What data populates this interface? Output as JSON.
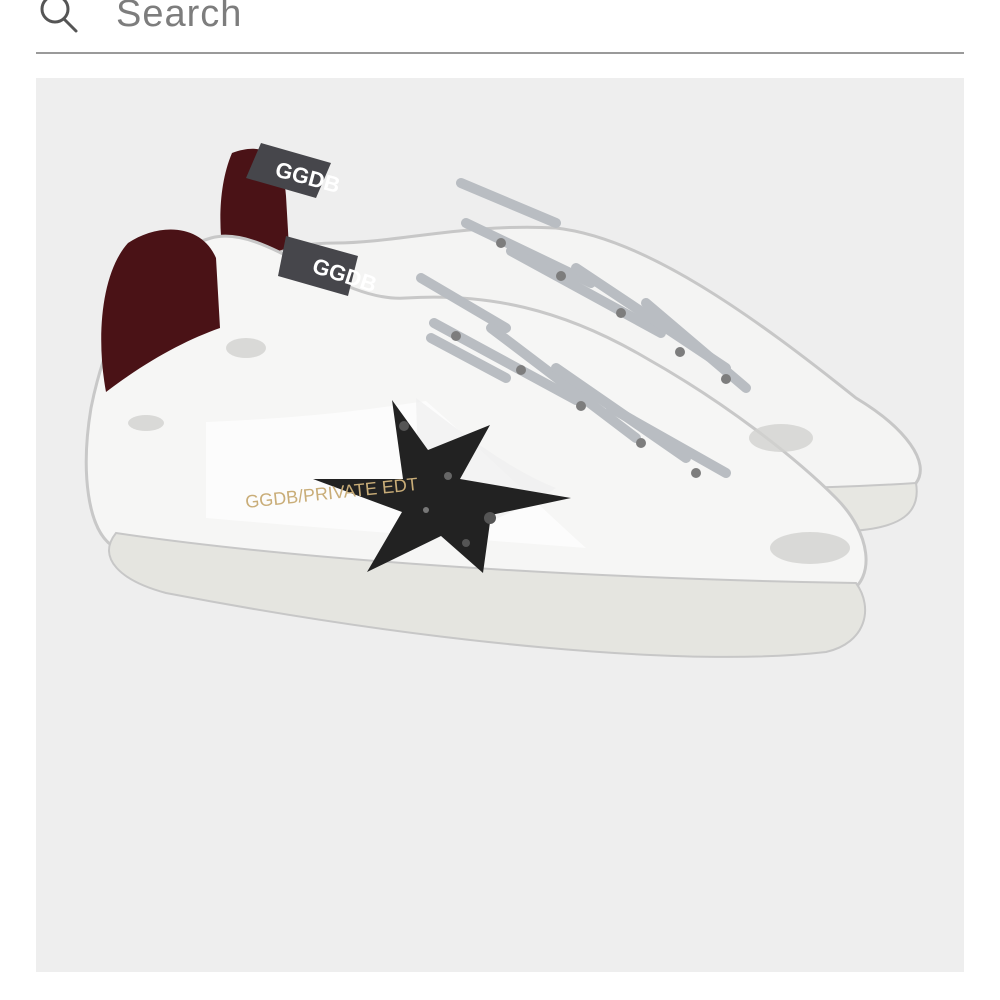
{
  "search": {
    "placeholder": "Search",
    "icon": "search-icon"
  },
  "product": {
    "image_alt": "white sneakers with black glitter star",
    "print_text": "GGDB/PRIVATE EDT",
    "tongue_label": "GGDB"
  },
  "colors": {
    "background": "#ffffff",
    "image_background": "#eeeeee",
    "search_underline": "#9a9a9a",
    "placeholder": "#7d7d7d",
    "heel_tab": "#4a1216",
    "star": "#222222",
    "laces": "#b9bdc2"
  }
}
